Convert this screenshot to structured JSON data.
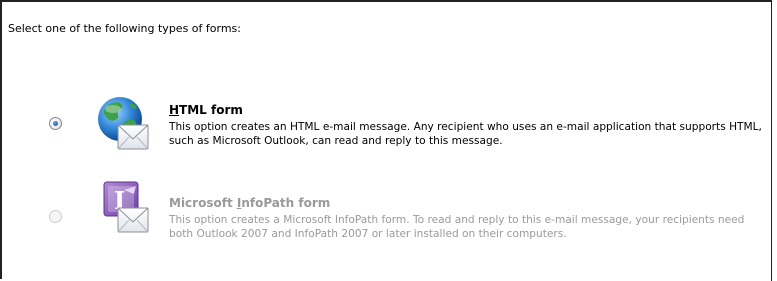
{
  "prompt": "Select one of the following types of forms:",
  "options": [
    {
      "title_accel": "H",
      "title_rest": "TML form",
      "description": "This option creates an HTML e-mail message. Any recipient who uses an e-mail application that supports HTML, such as Microsoft Outlook, can read and reply to this message.",
      "selected": true,
      "enabled": true,
      "icon": "globe-envelope-icon"
    },
    {
      "title_pre": "Microsoft ",
      "title_accel": "I",
      "title_rest": "nfoPath form",
      "description": "This option creates a Microsoft InfoPath form. To read and reply to this e-mail message, your recipients need both Outlook 2007 and InfoPath 2007 or later installed on their computers.",
      "selected": false,
      "enabled": false,
      "icon": "infopath-envelope-icon"
    }
  ]
}
